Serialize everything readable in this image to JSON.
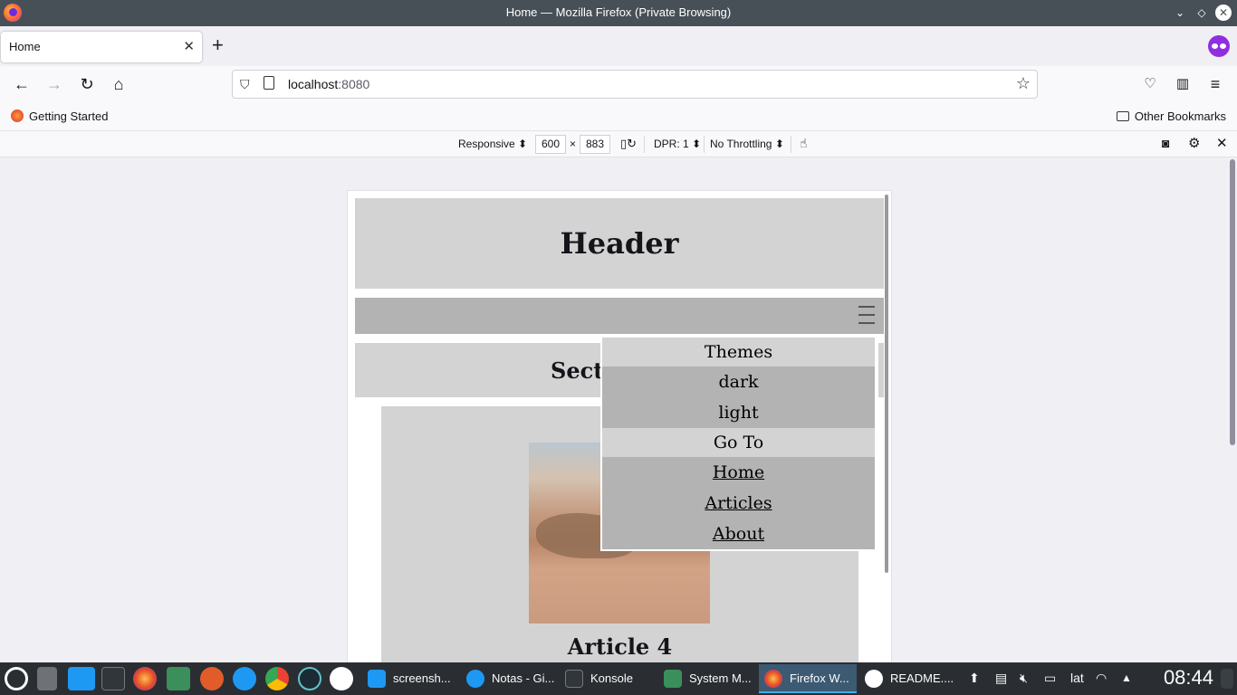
{
  "window": {
    "title": "Home — Mozilla Firefox (Private Browsing)"
  },
  "tabs": [
    {
      "label": "Home"
    }
  ],
  "nav": {
    "url_host": "localhost",
    "url_port": ":8080"
  },
  "bookmarks": {
    "left": "Getting Started",
    "right": "Other Bookmarks"
  },
  "rdm": {
    "device": "Responsive",
    "width": "600",
    "times": "×",
    "height": "883",
    "dpr": "DPR: 1",
    "throttling": "No Throttling"
  },
  "page": {
    "header": "Header",
    "section": "Secti",
    "article_title": "Article 4"
  },
  "menu": {
    "themes_label": "Themes",
    "themes": [
      "dark",
      "light"
    ],
    "goto_label": "Go To",
    "links": [
      "Home",
      "Articles",
      "About"
    ]
  },
  "taskbar": {
    "tasks": [
      "screensh...",
      "Notas - Gi...",
      "Konsole",
      "System M...",
      "Firefox W...",
      "README...."
    ],
    "keyboard_layout": "lat",
    "clock": "08:44"
  }
}
